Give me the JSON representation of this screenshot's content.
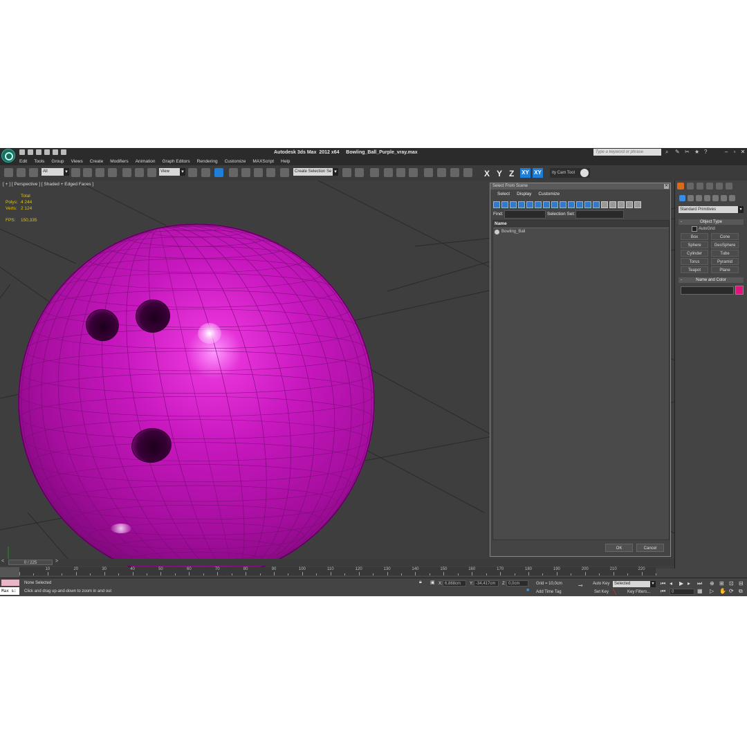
{
  "window": {
    "title": "Autodesk 3ds Max  2012 x64     Bowling_Ball_Purple_vray.max",
    "search_placeholder": "Type a keyword or phrase"
  },
  "menu": [
    "Edit",
    "Tools",
    "Group",
    "Views",
    "Create",
    "Modifiers",
    "Animation",
    "Graph Editors",
    "Rendering",
    "Customize",
    "MAXScript",
    "Help"
  ],
  "toolbar": {
    "filter": "All",
    "ref_coord": "View",
    "selection_set": "Create Selection Se",
    "axes": [
      "X",
      "Y",
      "Z",
      "XY"
    ],
    "active_axis": "XY",
    "cam_tool": "ity Cam Tool"
  },
  "viewport": {
    "label": "[ + ] [ Perspective ] [ Shaded + Edged Faces ]",
    "stats": {
      "total_label": "Total",
      "polys_label": "Polys:",
      "polys": "4 244",
      "verts_label": "Verts:",
      "verts": "2 124",
      "fps_label": "FPS:",
      "fps": "150,335"
    },
    "object_color": "#c818bf"
  },
  "dialog": {
    "title": "Select From Scene",
    "menu": [
      "Select",
      "Display",
      "Customize"
    ],
    "find_label": "Find:",
    "selection_set_label": "Selection Set:",
    "column_name": "Name",
    "items": [
      "Bowling_Ball"
    ],
    "ok": "OK",
    "cancel": "Cancel"
  },
  "command_panel": {
    "category": "Standard Primitives",
    "object_type_title": "Object Type",
    "autogrid": "AutoGrid",
    "primitives": [
      "Box",
      "Cone",
      "Sphere",
      "GeoSphere",
      "Cylinder",
      "Tube",
      "Torus",
      "Pyramid",
      "Teapot",
      "Plane"
    ],
    "name_color_title": "Name and Color",
    "color": "#e0147c"
  },
  "timeline": {
    "frame_display": "0 / 225",
    "ticks": [
      "10",
      "20",
      "30",
      "40",
      "50",
      "60",
      "70",
      "80",
      "90",
      "100",
      "110",
      "120",
      "130",
      "140",
      "150",
      "160",
      "170",
      "180",
      "190",
      "200",
      "210",
      "220"
    ]
  },
  "status": {
    "maxscript": "Max s:",
    "selection": "None Selected",
    "prompt": "Click and drag up-and-down to zoom in and out",
    "x_label": "X:",
    "x": "6,868cm",
    "y_label": "Y:",
    "y": "-34,417cm",
    "z_label": "Z:",
    "z": "0,0cm",
    "grid": "Grid = 10,0cm",
    "add_time_tag": "Add Time Tag",
    "auto_key": "Auto Key",
    "auto_key_mode": "Selected",
    "set_key": "Set Key",
    "key_filters": "Key Filters...",
    "current_frame": "0"
  }
}
